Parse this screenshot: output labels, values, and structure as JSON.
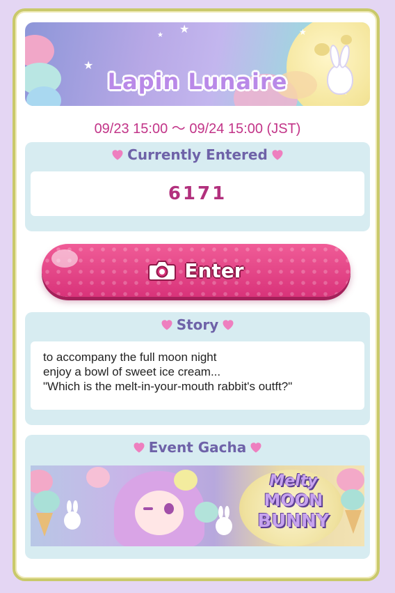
{
  "banner": {
    "title": "Lapin Lunaire"
  },
  "event_period": "09/23 15:00 ～ 09/24 15:00 (JST)",
  "entries": {
    "heading": "Currently Entered",
    "count": "6171"
  },
  "enter_button": {
    "label": "Enter",
    "icon": "camera-icon"
  },
  "story": {
    "heading": "Story",
    "lines": [
      "to accompany the full moon night",
      "enjoy a bowl of sweet ice cream...",
      "\"Which is the melt-in-your-mouth rabbit's outft?\""
    ]
  },
  "gacha": {
    "heading": "Event Gacha",
    "logo_lines": [
      "Melty",
      "MOON",
      "BUNNY"
    ]
  },
  "colors": {
    "accent_pink": "#d9337a",
    "date_magenta": "#c23488",
    "panel_bg": "#d7ecf1",
    "heading_purple": "#6e62a8",
    "frame_olive": "#c9c96b",
    "page_lavender": "#e4d6f3"
  },
  "icons": {
    "heart": "heart-icon",
    "star": "star-icon"
  }
}
